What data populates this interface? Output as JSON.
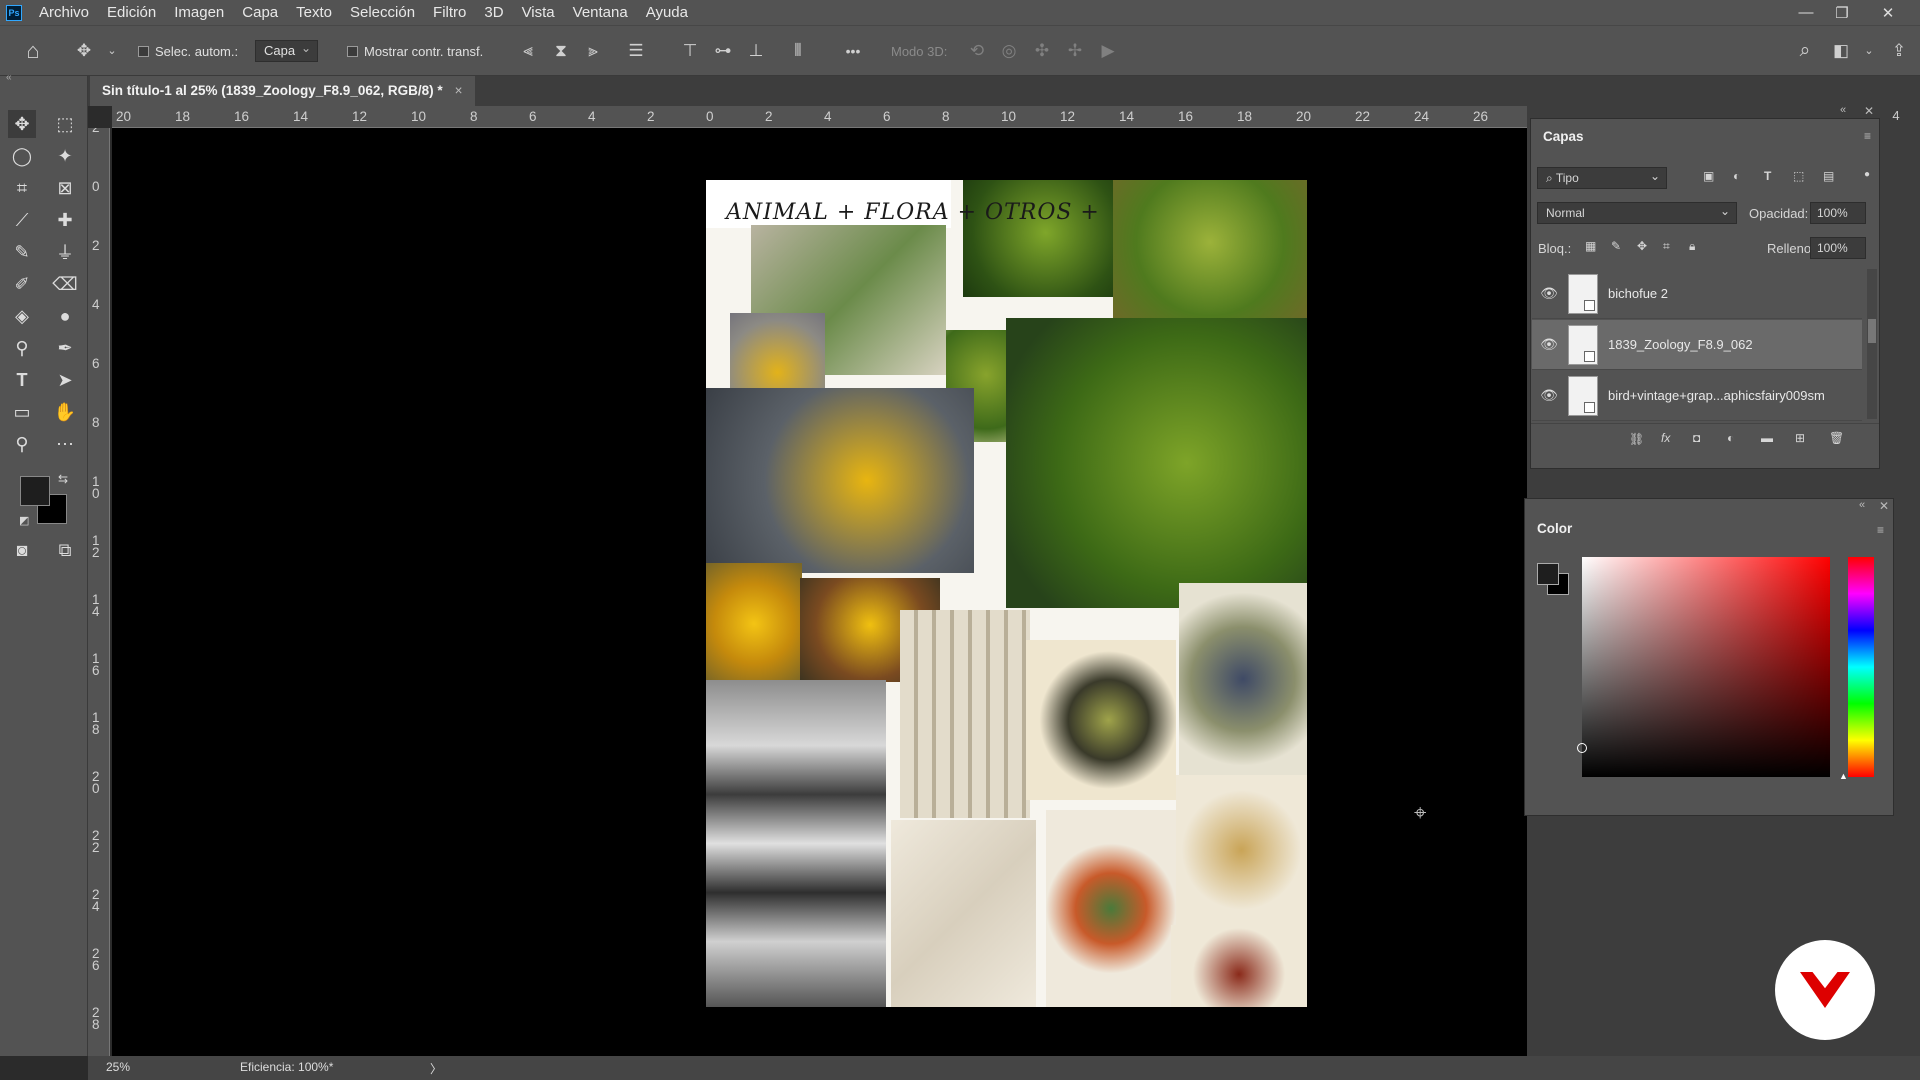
{
  "menubar": {
    "app_logo": "Ps",
    "items": [
      "Archivo",
      "Edición",
      "Imagen",
      "Capa",
      "Texto",
      "Selección",
      "Filtro",
      "3D",
      "Vista",
      "Ventana",
      "Ayuda"
    ]
  },
  "options": {
    "auto_select_label": "Selec. autom.:",
    "auto_select_value": "Capa",
    "show_transform_label": "Mostrar contr. transf.",
    "mode_3d_label": "Modo 3D:",
    "more_label": "•••"
  },
  "document": {
    "tab_title": "Sin título-1 al 25% (1839_Zoology_F8.9_062, RGB/8) *",
    "collage_heading": "ANIMAL + FLORA + OTROS +",
    "close_glyph": "×"
  },
  "rulers": {
    "horizontal": [
      "20",
      "18",
      "16",
      "14",
      "12",
      "10",
      "8",
      "6",
      "4",
      "2",
      "0",
      "2",
      "4",
      "6",
      "8",
      "10",
      "12",
      "14",
      "16",
      "18",
      "20",
      "22",
      "24",
      "26",
      "4"
    ],
    "vertical": [
      "2",
      "0",
      "2",
      "4",
      "6",
      "8",
      "1\n0",
      "1\n2",
      "1\n4",
      "1\n6",
      "1\n8",
      "2\n0",
      "2\n2",
      "2\n4",
      "2\n6",
      "2\n8"
    ]
  },
  "layers_panel": {
    "title": "Capas",
    "filter_value": "Tipo",
    "blend_mode": "Normal",
    "opacity_label": "Opacidad:",
    "opacity_value": "100%",
    "lock_label": "Bloq.:",
    "fill_label": "Relleno:",
    "fill_value": "100%",
    "layers": [
      {
        "name": "bichofue 2",
        "selected": false
      },
      {
        "name": "1839_Zoology_F8.9_062",
        "selected": true
      },
      {
        "name": "bird+vintage+grap...aphicsfairy009sm",
        "selected": false
      }
    ]
  },
  "color_panel": {
    "title": "Color",
    "foreground": "#1e1e1e",
    "background": "#000000"
  },
  "status": {
    "zoom": "25%",
    "efficiency": "Eficiencia: 100%*",
    "arrow": "〉"
  },
  "colors": {
    "accent": "#31a8ff",
    "chrome": "#535353",
    "dark_chrome": "#3d3d3d",
    "badge_red": "#dd0000"
  }
}
